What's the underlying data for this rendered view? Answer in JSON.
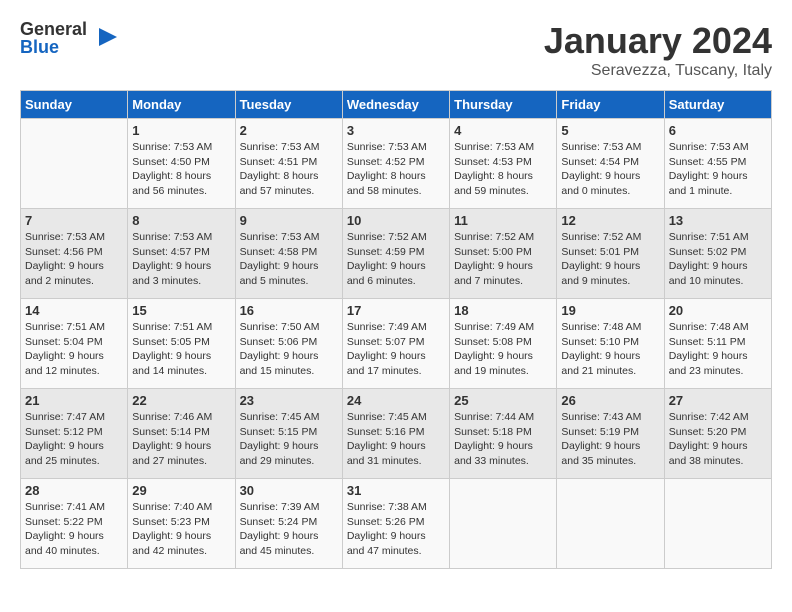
{
  "logo": {
    "general": "General",
    "blue": "Blue"
  },
  "title": "January 2024",
  "location": "Seravezza, Tuscany, Italy",
  "days_of_week": [
    "Sunday",
    "Monday",
    "Tuesday",
    "Wednesday",
    "Thursday",
    "Friday",
    "Saturday"
  ],
  "weeks": [
    [
      {
        "day": "",
        "info": ""
      },
      {
        "day": "1",
        "info": "Sunrise: 7:53 AM\nSunset: 4:50 PM\nDaylight: 8 hours\nand 56 minutes."
      },
      {
        "day": "2",
        "info": "Sunrise: 7:53 AM\nSunset: 4:51 PM\nDaylight: 8 hours\nand 57 minutes."
      },
      {
        "day": "3",
        "info": "Sunrise: 7:53 AM\nSunset: 4:52 PM\nDaylight: 8 hours\nand 58 minutes."
      },
      {
        "day": "4",
        "info": "Sunrise: 7:53 AM\nSunset: 4:53 PM\nDaylight: 8 hours\nand 59 minutes."
      },
      {
        "day": "5",
        "info": "Sunrise: 7:53 AM\nSunset: 4:54 PM\nDaylight: 9 hours\nand 0 minutes."
      },
      {
        "day": "6",
        "info": "Sunrise: 7:53 AM\nSunset: 4:55 PM\nDaylight: 9 hours\nand 1 minute."
      }
    ],
    [
      {
        "day": "7",
        "info": "Sunrise: 7:53 AM\nSunset: 4:56 PM\nDaylight: 9 hours\nand 2 minutes."
      },
      {
        "day": "8",
        "info": "Sunrise: 7:53 AM\nSunset: 4:57 PM\nDaylight: 9 hours\nand 3 minutes."
      },
      {
        "day": "9",
        "info": "Sunrise: 7:53 AM\nSunset: 4:58 PM\nDaylight: 9 hours\nand 5 minutes."
      },
      {
        "day": "10",
        "info": "Sunrise: 7:52 AM\nSunset: 4:59 PM\nDaylight: 9 hours\nand 6 minutes."
      },
      {
        "day": "11",
        "info": "Sunrise: 7:52 AM\nSunset: 5:00 PM\nDaylight: 9 hours\nand 7 minutes."
      },
      {
        "day": "12",
        "info": "Sunrise: 7:52 AM\nSunset: 5:01 PM\nDaylight: 9 hours\nand 9 minutes."
      },
      {
        "day": "13",
        "info": "Sunrise: 7:51 AM\nSunset: 5:02 PM\nDaylight: 9 hours\nand 10 minutes."
      }
    ],
    [
      {
        "day": "14",
        "info": "Sunrise: 7:51 AM\nSunset: 5:04 PM\nDaylight: 9 hours\nand 12 minutes."
      },
      {
        "day": "15",
        "info": "Sunrise: 7:51 AM\nSunset: 5:05 PM\nDaylight: 9 hours\nand 14 minutes."
      },
      {
        "day": "16",
        "info": "Sunrise: 7:50 AM\nSunset: 5:06 PM\nDaylight: 9 hours\nand 15 minutes."
      },
      {
        "day": "17",
        "info": "Sunrise: 7:49 AM\nSunset: 5:07 PM\nDaylight: 9 hours\nand 17 minutes."
      },
      {
        "day": "18",
        "info": "Sunrise: 7:49 AM\nSunset: 5:08 PM\nDaylight: 9 hours\nand 19 minutes."
      },
      {
        "day": "19",
        "info": "Sunrise: 7:48 AM\nSunset: 5:10 PM\nDaylight: 9 hours\nand 21 minutes."
      },
      {
        "day": "20",
        "info": "Sunrise: 7:48 AM\nSunset: 5:11 PM\nDaylight: 9 hours\nand 23 minutes."
      }
    ],
    [
      {
        "day": "21",
        "info": "Sunrise: 7:47 AM\nSunset: 5:12 PM\nDaylight: 9 hours\nand 25 minutes."
      },
      {
        "day": "22",
        "info": "Sunrise: 7:46 AM\nSunset: 5:14 PM\nDaylight: 9 hours\nand 27 minutes."
      },
      {
        "day": "23",
        "info": "Sunrise: 7:45 AM\nSunset: 5:15 PM\nDaylight: 9 hours\nand 29 minutes."
      },
      {
        "day": "24",
        "info": "Sunrise: 7:45 AM\nSunset: 5:16 PM\nDaylight: 9 hours\nand 31 minutes."
      },
      {
        "day": "25",
        "info": "Sunrise: 7:44 AM\nSunset: 5:18 PM\nDaylight: 9 hours\nand 33 minutes."
      },
      {
        "day": "26",
        "info": "Sunrise: 7:43 AM\nSunset: 5:19 PM\nDaylight: 9 hours\nand 35 minutes."
      },
      {
        "day": "27",
        "info": "Sunrise: 7:42 AM\nSunset: 5:20 PM\nDaylight: 9 hours\nand 38 minutes."
      }
    ],
    [
      {
        "day": "28",
        "info": "Sunrise: 7:41 AM\nSunset: 5:22 PM\nDaylight: 9 hours\nand 40 minutes."
      },
      {
        "day": "29",
        "info": "Sunrise: 7:40 AM\nSunset: 5:23 PM\nDaylight: 9 hours\nand 42 minutes."
      },
      {
        "day": "30",
        "info": "Sunrise: 7:39 AM\nSunset: 5:24 PM\nDaylight: 9 hours\nand 45 minutes."
      },
      {
        "day": "31",
        "info": "Sunrise: 7:38 AM\nSunset: 5:26 PM\nDaylight: 9 hours\nand 47 minutes."
      },
      {
        "day": "",
        "info": ""
      },
      {
        "day": "",
        "info": ""
      },
      {
        "day": "",
        "info": ""
      }
    ]
  ]
}
